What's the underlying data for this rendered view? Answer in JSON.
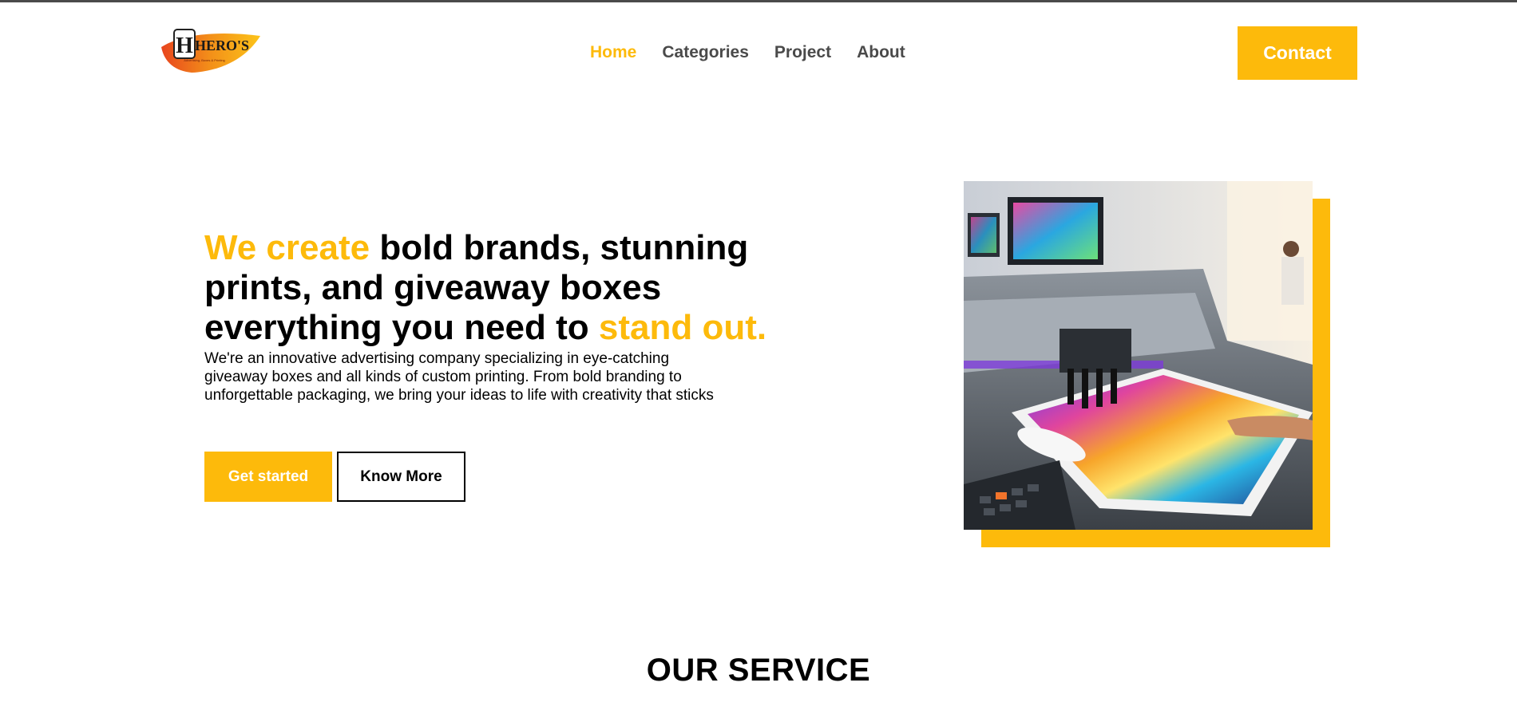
{
  "brand": {
    "logo_text": "HERO'S",
    "logo_tagline": "Advertising, Boxes & Printing",
    "colors": {
      "accent": "#FDBA0B",
      "nav_text": "#4a4a4a",
      "text": "#000000",
      "background": "#ffffff"
    }
  },
  "nav": {
    "items": [
      {
        "label": "Home",
        "active": true
      },
      {
        "label": "Categories",
        "active": false
      },
      {
        "label": "Project",
        "active": false
      },
      {
        "label": "About",
        "active": false
      }
    ],
    "contact_label": "Contact"
  },
  "hero": {
    "title_accent_1": "We create",
    "title_middle": " bold brands, stunning prints, and giveaway boxes everything you need to ",
    "title_accent_2": "stand out.",
    "description": "We're an innovative advertising company specializing in eye-catching giveaway boxes and all kinds of custom printing. From bold branding to unforgettable packaging, we bring your ideas to life with creativity that sticks",
    "primary_button": "Get started",
    "secondary_button": "Know More",
    "image_icon": "printer-photo-icon"
  },
  "services": {
    "title": "OUR SERVICE"
  }
}
